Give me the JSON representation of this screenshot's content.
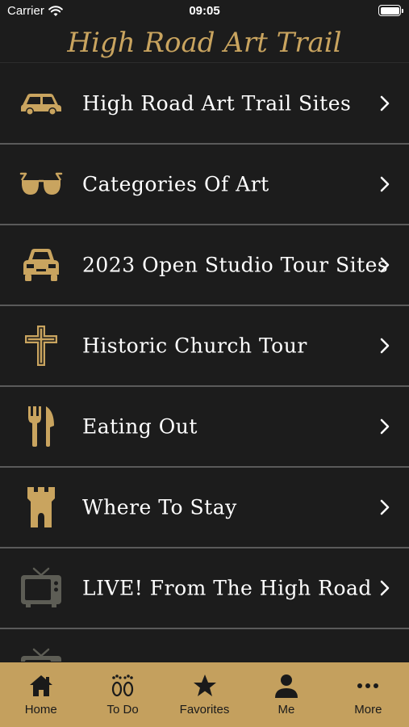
{
  "status_bar": {
    "carrier": "Carrier",
    "time": "09:05"
  },
  "header": {
    "title": "High Road Art Trail"
  },
  "colors": {
    "accent": "#c9a45f",
    "tab_bar": "#c4a05e",
    "background": "#1c1c1c",
    "divider": "#5a5a5a"
  },
  "menu": {
    "items": [
      {
        "label": "High Road Art Trail Sites",
        "icon": "car-side-icon"
      },
      {
        "label": "Categories Of Art",
        "icon": "sunglasses-icon"
      },
      {
        "label": "2023 Open Studio Tour Sites",
        "icon": "car-front-icon"
      },
      {
        "label": "Historic Church Tour",
        "icon": "cross-icon"
      },
      {
        "label": "Eating Out",
        "icon": "fork-knife-icon"
      },
      {
        "label": "Where To Stay",
        "icon": "castle-tower-icon"
      },
      {
        "label": "LIVE! From The High Road",
        "icon": "tv-icon"
      },
      {
        "label": "",
        "icon": "tv-icon"
      }
    ]
  },
  "tabs": [
    {
      "label": "Home",
      "icon": "home-icon"
    },
    {
      "label": "To Do",
      "icon": "footprints-icon"
    },
    {
      "label": "Favorites",
      "icon": "star-icon"
    },
    {
      "label": "Me",
      "icon": "person-icon"
    },
    {
      "label": "More",
      "icon": "more-dots-icon"
    }
  ]
}
